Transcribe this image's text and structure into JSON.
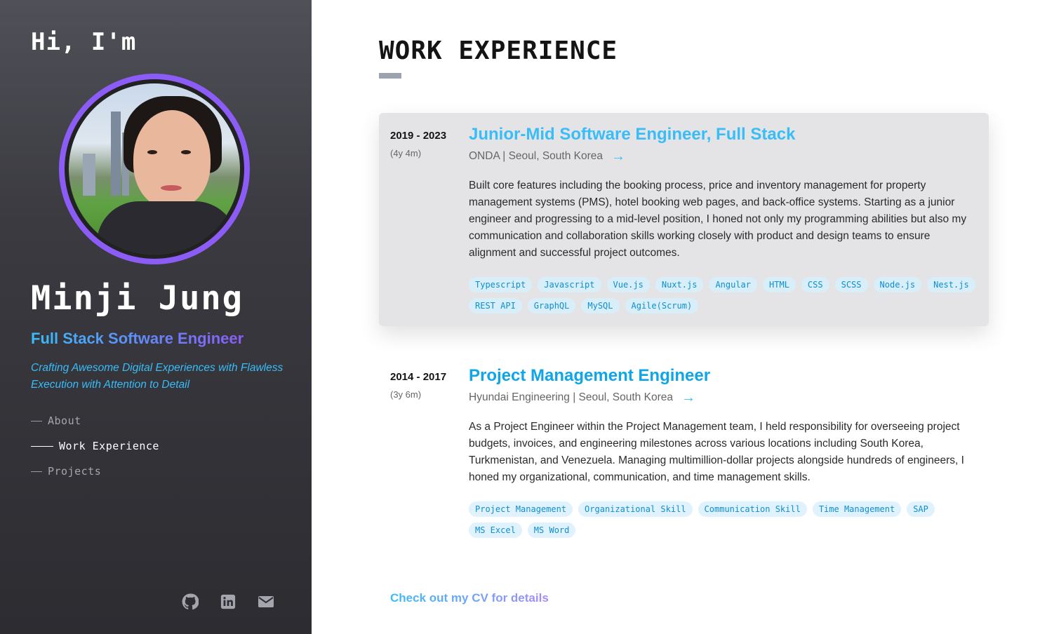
{
  "sidebar": {
    "greeting": "Hi, I'm",
    "name": "Minji Jung",
    "role": "Full Stack Software Engineer",
    "tagline": "Crafting Awesome Digital Experiences with Flawless Execution with Attention to Detail",
    "nav": [
      {
        "label": "About",
        "active": false
      },
      {
        "label": "Work Experience",
        "active": true
      },
      {
        "label": "Projects",
        "active": false
      }
    ],
    "socials": [
      "github-icon",
      "linkedin-icon",
      "mail-icon"
    ]
  },
  "main": {
    "section_title": "WORK EXPERIENCE",
    "jobs": [
      {
        "period": "2019 - 2023",
        "duration": "(4y 4m)",
        "title": "Junior-Mid Software Engineer, Full Stack",
        "company": "ONDA | Seoul, South Korea",
        "description": "Built core features including the booking process, price and inventory management for property management systems (PMS), hotel booking web pages, and back-office systems. Starting as a junior engineer and progressing to a mid-level position, I honed not only my programming abilities but also my communication and collaboration skills working closely with product and design teams to ensure alignment and successful project outcomes.",
        "tags": [
          "Typescript",
          "Javascript",
          "Vue.js",
          "Nuxt.js",
          "Angular",
          "HTML",
          "CSS",
          "SCSS",
          "Node.js",
          "Nest.js",
          "REST API",
          "GraphQL",
          "MySQL",
          "Agile(Scrum)"
        ]
      },
      {
        "period": "2014 - 2017",
        "duration": "(3y 6m)",
        "title": "Project Management Engineer",
        "company": "Hyundai Engineering | Seoul, South Korea",
        "description": "As a Project Engineer within the Project Management team, I held responsibility for overseeing project budgets, invoices, and engineering milestones across various locations including South Korea, Turkmenistan, and Venezuela. Managing multimillion-dollar projects alongside hundreds of engineers, I honed my organizational, communication, and time management skills.",
        "tags": [
          "Project Management",
          "Organizational Skill",
          "Communication Skill",
          "Time Management",
          "SAP",
          "MS Excel",
          "MS Word"
        ]
      }
    ],
    "cv_link": "Check out my CV for details"
  },
  "colors": {
    "accent_blue": "#38bdf8",
    "accent_purple": "#8b5cf6",
    "tag_bg": "#e0f2fe",
    "tag_text": "#0e8fcf"
  }
}
